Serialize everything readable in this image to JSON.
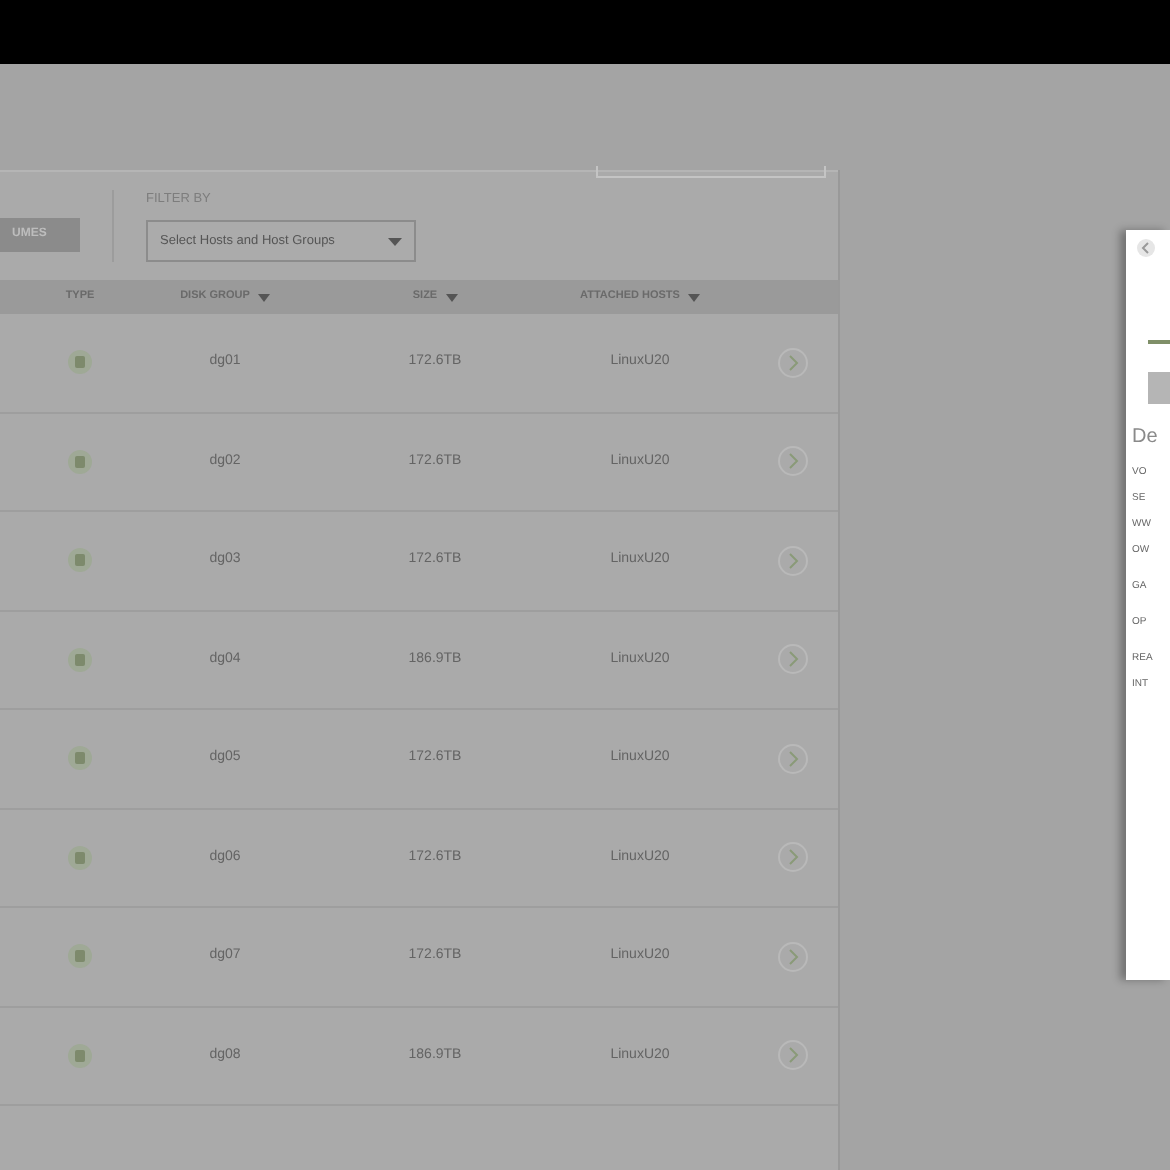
{
  "toolbar": {
    "button_label": "UMES",
    "filter_label": "FILTER BY",
    "filter_placeholder": "Select Hosts and Host Groups"
  },
  "table": {
    "columns": [
      {
        "label": "TYPE",
        "sortable": false
      },
      {
        "label": "DISK GROUP",
        "sortable": true
      },
      {
        "label": "SIZE",
        "sortable": true
      },
      {
        "label": "ATTACHED HOSTS",
        "sortable": true
      }
    ],
    "rows": [
      {
        "disk_group": "dg01",
        "size": "172.6TB",
        "attached_hosts": "LinuxU20"
      },
      {
        "disk_group": "dg02",
        "size": "172.6TB",
        "attached_hosts": "LinuxU20"
      },
      {
        "disk_group": "dg03",
        "size": "172.6TB",
        "attached_hosts": "LinuxU20"
      },
      {
        "disk_group": "dg04",
        "size": "186.9TB",
        "attached_hosts": "LinuxU20"
      },
      {
        "disk_group": "dg05",
        "size": "172.6TB",
        "attached_hosts": "LinuxU20"
      },
      {
        "disk_group": "dg06",
        "size": "172.6TB",
        "attached_hosts": "LinuxU20"
      },
      {
        "disk_group": "dg07",
        "size": "172.6TB",
        "attached_hosts": "LinuxU20"
      },
      {
        "disk_group": "dg08",
        "size": "186.9TB",
        "attached_hosts": "LinuxU20"
      }
    ]
  },
  "detail_panel": {
    "title": "De",
    "fields": [
      "VO",
      "SE",
      "WW",
      "OW",
      "GA",
      "OP",
      "REA",
      "INT"
    ]
  }
}
